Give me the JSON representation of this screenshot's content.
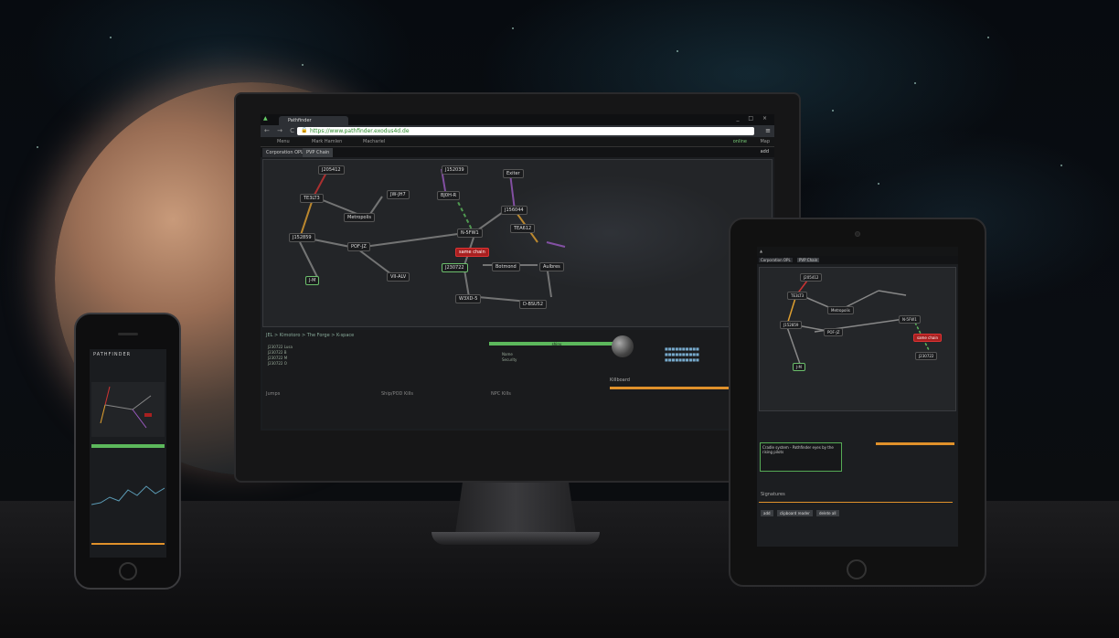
{
  "browser": {
    "tab_title": "Pathfinder",
    "url": "https://www.pathfinder.exodus4d.de",
    "window_controls": "_ □ ×",
    "nav_buttons": "← → C"
  },
  "app_nav": {
    "menu": "Menu",
    "char1": "Mark Hamlen",
    "char2": "Machariel",
    "status": "online",
    "map": "Map"
  },
  "map_tabs": {
    "corp": "Corporation OPL",
    "pvp": "PVP Chain",
    "add": "add"
  },
  "systems": [
    {
      "label": "J205412"
    },
    {
      "label": "TE3LT3"
    },
    {
      "label": "JW-JH7"
    },
    {
      "label": "Metropolis"
    },
    {
      "label": "J152859"
    },
    {
      "label": "POF-JZ"
    },
    {
      "label": "VII-ALV"
    },
    {
      "label": "J-M"
    },
    {
      "label": "J152039"
    },
    {
      "label": "Exiter"
    },
    {
      "label": "BJ0H-R"
    },
    {
      "label": "J156044"
    },
    {
      "label": "N-5FW1"
    },
    {
      "label": "TEA612"
    },
    {
      "label": "J230722"
    },
    {
      "label": "Botmond"
    },
    {
      "label": "Aulbres"
    },
    {
      "label": "W3XD-5"
    },
    {
      "label": "D-BSU52"
    },
    {
      "label": "same chain"
    }
  ],
  "info": {
    "breadcrumb": "JEL > Kimotoro > The Forge > K-space",
    "green_label": "shiny",
    "rows": [
      "J230722 Lusa",
      "J230722 B",
      "J230722 M",
      "J230722 O"
    ],
    "stat_labels": [
      "Name",
      "Security"
    ],
    "jumps": "Jumps",
    "ship_kills": "Ship/POD Kills",
    "npc_kills": "NPC Kills",
    "killboard": "Killboard"
  },
  "tablet": {
    "tab1": "Corporation OPL",
    "tab2": "PVP Chain",
    "textarea": "Cradle system - Pathfinder eyes by the rising pilots",
    "signatures": "Signatures",
    "btn_add": "add",
    "btn_clipboard": "clipboard reader",
    "btn_delete": "delete all"
  },
  "phone": {
    "logo": "PATHFINDER"
  },
  "colors": {
    "accent_green": "#5cb85c",
    "accent_orange": "#e0912b",
    "alert_red": "#a82020"
  }
}
